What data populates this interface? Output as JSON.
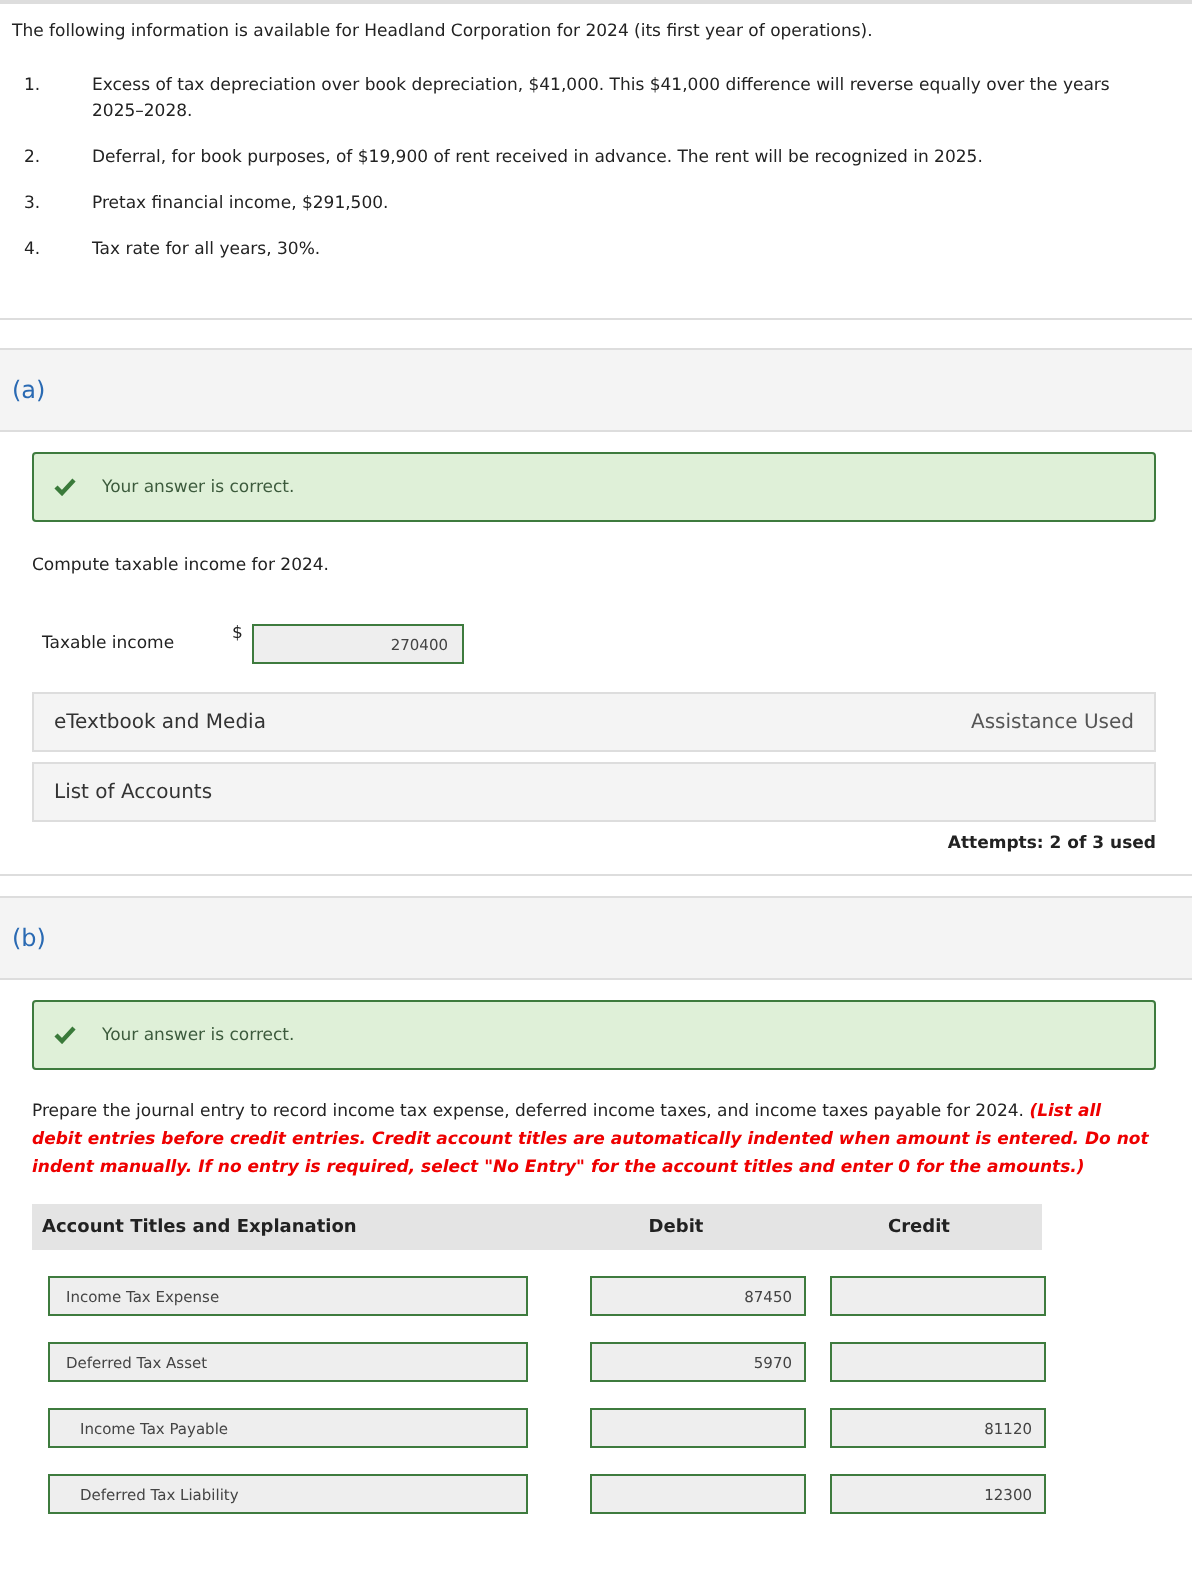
{
  "intro": "The following information is available for Headland Corporation for 2024 (its first year of operations).",
  "facts": [
    {
      "number": "1.",
      "text": "Excess of tax depreciation over book depreciation, $41,000. This $41,000 difference will reverse equally over the years 2025–2028."
    },
    {
      "number": "2.",
      "text": "Deferral, for book purposes, of $19,900 of rent received in advance. The rent will be recognized in 2025."
    },
    {
      "number": "3.",
      "text": "Pretax financial income, $291,500."
    },
    {
      "number": "4.",
      "text": "Tax rate for all years, 30%."
    }
  ],
  "part_a": {
    "label": "(a)",
    "feedback": {
      "correct": true,
      "text": "Your answer is correct."
    },
    "prompt": "Compute taxable income for 2024.",
    "field": {
      "label": "Taxable income",
      "currency": "$",
      "value": "270400"
    },
    "resources": [
      {
        "title": "eTextbook and Media",
        "note": "Assistance Used"
      },
      {
        "title": "List of Accounts"
      }
    ],
    "attempts": "Attempts: 2 of 3 used"
  },
  "part_b": {
    "label": "(b)",
    "feedback": {
      "correct": true,
      "text": "Your answer is correct."
    },
    "prompt": "Prepare the journal entry to record income tax expense, deferred income taxes, and income taxes payable for 2024.",
    "instructions": "(List all debit entries before credit entries. Credit account titles are automatically indented when amount is entered. Do not indent manually. If no entry is required, select \"No Entry\" for the account titles and enter 0 for the amounts.)",
    "table": {
      "columns": [
        "Account Titles and Explanation",
        "Debit",
        "Credit"
      ],
      "rows": [
        {
          "account": "Income Tax Expense",
          "indented": false,
          "debit": "87450"
        },
        {
          "account": "Deferred Tax Asset",
          "indented": false,
          "debit": "5970"
        },
        {
          "account": "Income Tax Payable",
          "indented": true,
          "credit": "81120"
        },
        {
          "account": "Deferred Tax Liability",
          "indented": true,
          "credit": "12300"
        }
      ]
    }
  }
}
